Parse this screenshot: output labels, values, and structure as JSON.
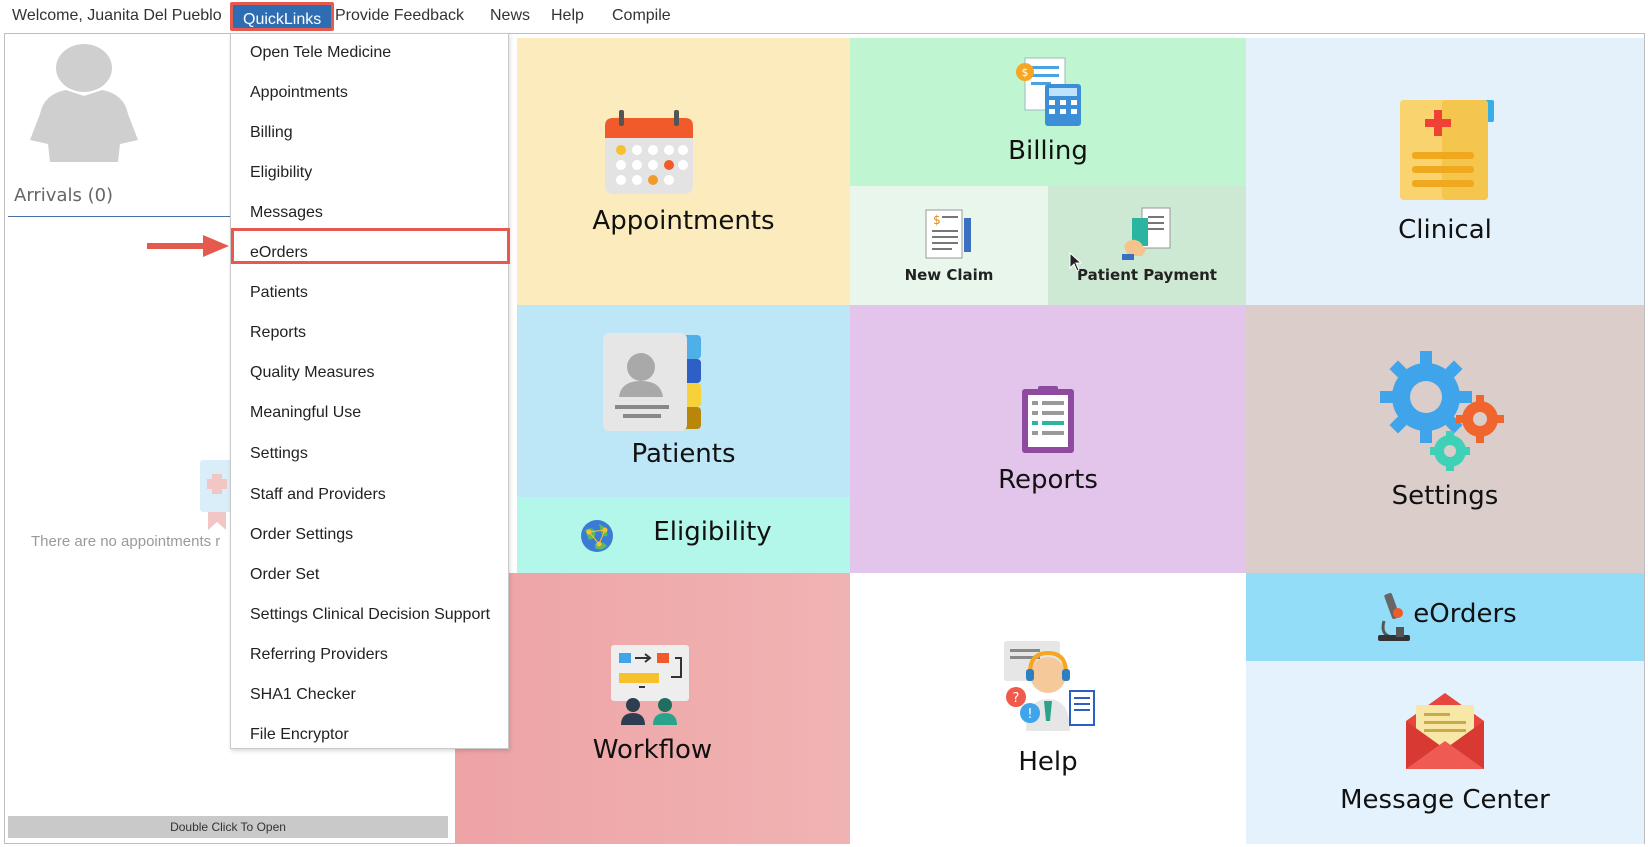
{
  "topbar": {
    "welcome": "Welcome, Juanita Del Pueblo",
    "quicklinks": "QuickLinks",
    "feedback": "Provide Feedback",
    "news": "News",
    "help": "Help",
    "compile": "Compile"
  },
  "left_panel": {
    "arrivals": "Arrivals (0)",
    "no_appointments": "There are no appointments r",
    "double_click": "Double Click To Open"
  },
  "dropdown": {
    "items": [
      "Open Tele Medicine",
      "Appointments",
      "Billing",
      "Eligibility",
      "Messages",
      "eOrders",
      "Patients",
      "Reports",
      "Quality Measures",
      "Meaningful Use",
      "Settings",
      "Staff and Providers",
      "Order Settings",
      "Order Set",
      "Settings Clinical Decision Support",
      "Referring Providers",
      "SHA1 Checker",
      "File Encryptor"
    ],
    "highlighted": "eOrders"
  },
  "tiles": {
    "appointments": "Appointments",
    "billing": "Billing",
    "new_claim": "New Claim",
    "patient_payment": "Patient Payment",
    "clinical": "Clinical",
    "patients": "Patients",
    "eligibility": "Eligibility",
    "reports": "Reports",
    "settings": "Settings",
    "workflow": "Workflow",
    "help": "Help",
    "eorders": "eOrders",
    "message_center": "Message Center"
  },
  "colors": {
    "appointments_bg": "#fcebbd",
    "billing_bg": "#c0f5d1",
    "new_claim_bg": "#e8f6ec",
    "patient_payment_bg": "#cde8d3",
    "clinical_bg": "#e4f1fb",
    "patients_bg": "#bde6f7",
    "eligibility_bg": "#b2f7ea",
    "reports_bg": "#e3c4ea",
    "settings_bg": "#dacdca",
    "workflow_bg": "#eea3a5",
    "help_bg": "#ffffff",
    "eorders_bg": "#93ddf9",
    "message_center_bg": "#e3f2fc",
    "highlight": "#e55a4e",
    "quicklinks_bg": "#2f6db3"
  }
}
